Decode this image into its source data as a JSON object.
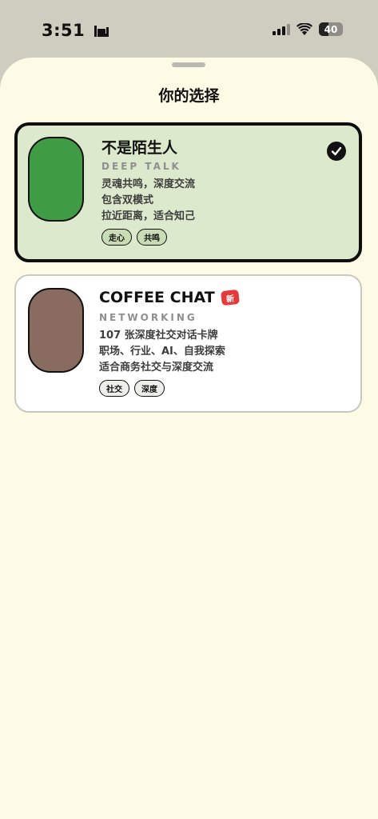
{
  "status_bar": {
    "time": "3:51",
    "battery_level": "40",
    "battery_fraction": 0.4
  },
  "sheet": {
    "title": "你的选择"
  },
  "options": [
    {
      "title": "不是陌生人",
      "subtitle": "DEEP TALK",
      "description": [
        "灵魂共鸣，深度交流",
        "包含双模式",
        "拉近距离，适合知己"
      ],
      "tags": [
        "走心",
        "共鸣"
      ],
      "avatar_color": "#3f9c44",
      "selected": true
    },
    {
      "title": "COFFEE CHAT",
      "badge": "新",
      "subtitle": "NETWORKING",
      "description": [
        "107 张深度社交对话卡牌",
        "职场、行业、AI、自我探索",
        "适合商务社交与深度交流"
      ],
      "tags": [
        "社交",
        "深度"
      ],
      "avatar_color": "#896b5f",
      "selected": false
    }
  ],
  "colors": {
    "sheet_background": "#fdfbe6",
    "selected_card_background": "#dde9cc",
    "badge_red": "#e63a3a"
  }
}
